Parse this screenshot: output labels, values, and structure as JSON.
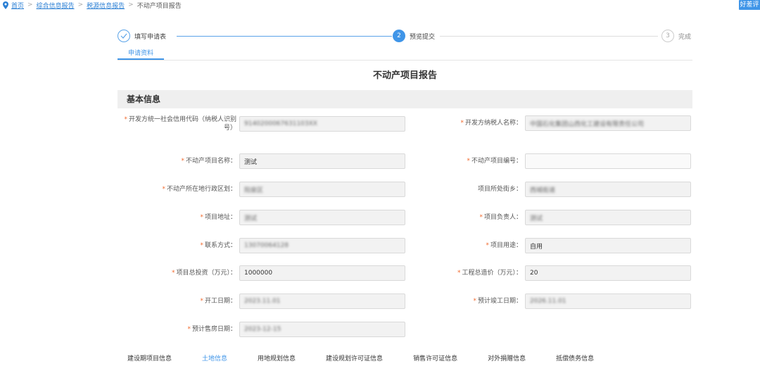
{
  "breadcrumb": {
    "home": "首页",
    "items": [
      "综合信息报告",
      "税源信息报告"
    ],
    "current": "不动产项目报告"
  },
  "review_button": "好差评",
  "steps": [
    {
      "index": "1",
      "label": "填写申请表",
      "state": "done"
    },
    {
      "index": "2",
      "label": "预览提交",
      "state": "active"
    },
    {
      "index": "3",
      "label": "完成",
      "state": "todo"
    }
  ],
  "subtab": "申请资料",
  "page_title": "不动产项目报告",
  "section_title": "基本信息",
  "fields": {
    "credit_code": {
      "label": "开发方统一社会信用代码（纳税人识别号）",
      "value": "9140200067631103XX",
      "required": true
    },
    "taxpayer_name": {
      "label": "开发方纳税人名称：",
      "value": "中国石化集团山西化工建设有限责任公司",
      "required": true
    },
    "project_name": {
      "label": "不动产项目名称：",
      "value": "测试",
      "required": true
    },
    "project_no": {
      "label": "不动产项目编号：",
      "value": "",
      "required": true
    },
    "district": {
      "label": "不动产所在地行政区划：",
      "value": "阳泉区",
      "required": true
    },
    "street": {
      "label": "项目所处街乡：",
      "value": "西城街道",
      "required": false
    },
    "address": {
      "label": "项目地址：",
      "value": "测试",
      "required": true
    },
    "manager": {
      "label": "项目负责人：",
      "value": "测试",
      "required": true
    },
    "contact": {
      "label": "联系方式：",
      "value": "13070064128",
      "required": true
    },
    "usage": {
      "label": "项目用途：",
      "value": "自用",
      "required": true
    },
    "total_invest": {
      "label": "项目总投资（万元）：",
      "value": "1000000",
      "required": true
    },
    "total_cost": {
      "label": "工程总造价（万元）：",
      "value": "20",
      "required": true
    },
    "start_date": {
      "label": "开工日期：",
      "value": "2023.11.01",
      "required": true
    },
    "finish_date": {
      "label": "预计竣工日期：",
      "value": "2026.11.01",
      "required": true
    },
    "sale_date": {
      "label": "预计售房日期：",
      "value": "2023-12-15",
      "required": true
    }
  },
  "bottom_tabs": [
    "建设期项目信息",
    "土地信息",
    "用地规划信息",
    "建设规划许可证信息",
    "销售许可证信息",
    "对外捐赠信息",
    "抵偿债务信息"
  ],
  "bottom_tab_active": "土地信息",
  "colors": {
    "accent": "#3f95e8",
    "required": "#f26a2e",
    "section_bg": "#efefef"
  }
}
